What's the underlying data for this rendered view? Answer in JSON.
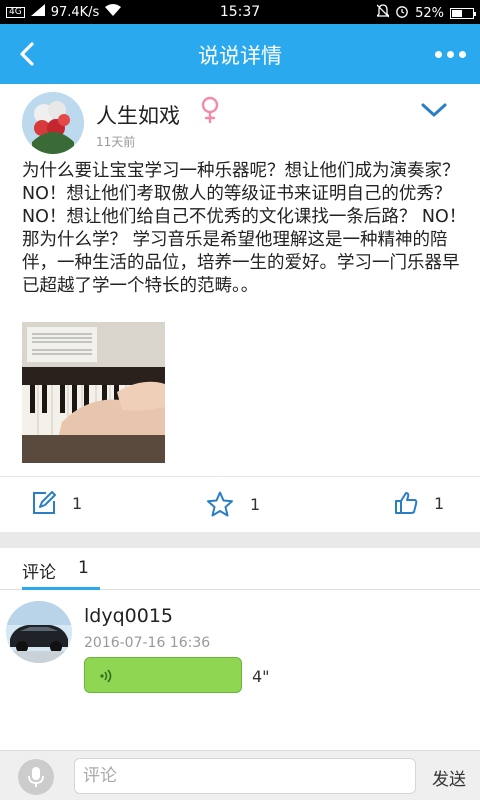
{
  "status_bar": {
    "network": "4G",
    "speed": "97.4K/s",
    "time": "15:37",
    "battery": "52%",
    "battery_level": 0.52
  },
  "header": {
    "title": "说说详情"
  },
  "post": {
    "username": "人生如戏",
    "time": "11天前",
    "text": "为什么要让宝宝学习一种乐器呢？想让他们成为演奏家？NO！想让他们考取傲人的等级证书来证明自己的优秀？NO！想让他们给自己不优秀的文化课找一条后路？ NO！ 那为什么学？ 学习音乐是希望他理解这是一种精神的陪伴，一种生活的品位，培养一生的爱好。学习一门乐器早已超越了学一个特长的范畴。。",
    "actions": {
      "comment_count": "1",
      "favorite_count": "1",
      "like_count": "1"
    }
  },
  "comments_tab": {
    "label": "评论",
    "count": "1"
  },
  "comments": [
    {
      "username": "ldyq0015",
      "time": "2016-07-16 16:36",
      "voice_duration": "4\""
    }
  ],
  "input_bar": {
    "placeholder": "评论",
    "send_label": "发送"
  },
  "colors": {
    "brand": "#2aa9ee",
    "voice_bubble": "#8fd653",
    "female": "#f48aa6"
  }
}
